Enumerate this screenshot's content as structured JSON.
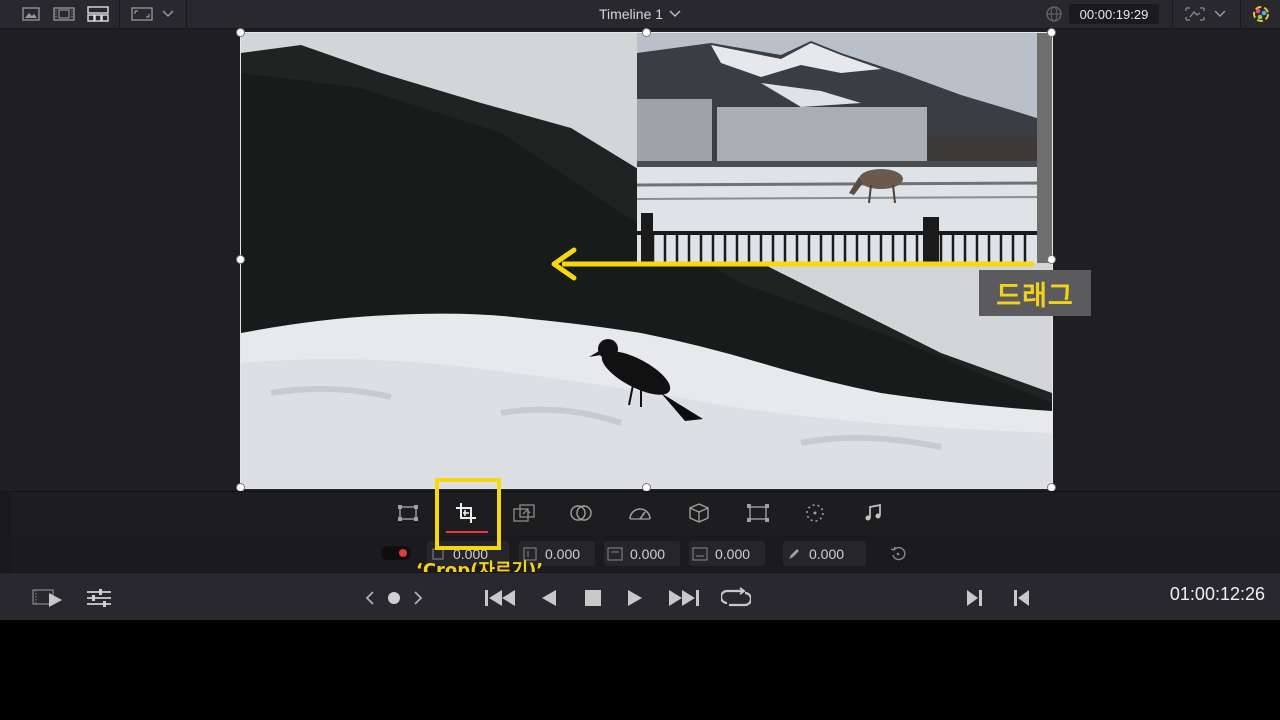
{
  "topbar": {
    "timeline_title": "Timeline 1",
    "timecode": "00:00:19:29",
    "icons": [
      "media-thumbnail-icon",
      "film-strip-icon",
      "grid-view-icon",
      "viewer-size-icon",
      "chevron-down-icon",
      "globe-icon",
      "transform-overlay-icon",
      "color-wheel-icon"
    ]
  },
  "viewer": {
    "drag_label": "드래그",
    "arrow_color": "#f7d70e"
  },
  "tools": {
    "items": [
      "transform-icon",
      "crop-icon",
      "dynamic-zoom-icon",
      "composite-icon",
      "speed-icon",
      "stabilization-icon",
      "lens-correction-icon",
      "retime-icon",
      "audio-icon"
    ],
    "active": "crop-icon",
    "crop_label": "‘Crop(자르기)’"
  },
  "params": {
    "field1": "0.000",
    "field2": "0.000",
    "field3": "0.000",
    "field4": "0.000",
    "softness": "0.000"
  },
  "transport": {
    "timecode": "01:00:12:26"
  },
  "colors": {
    "highlight": "#f7d70e",
    "active_underline": "#e53b3b",
    "panel_bg": "#1f1f23",
    "toolbar_bg": "#28282e"
  }
}
